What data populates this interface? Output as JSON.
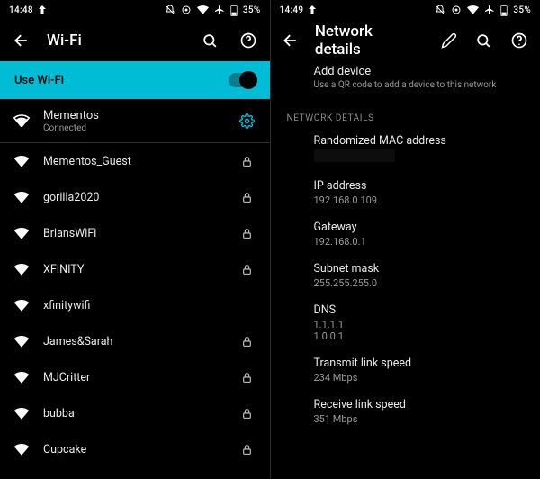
{
  "left": {
    "status": {
      "time": "14:48",
      "battery": "35%"
    },
    "title": "Wi-Fi",
    "toggleLabel": "Use Wi-Fi",
    "connected": {
      "name": "Mementos",
      "status": "Connected"
    },
    "networks": [
      {
        "name": "Mementos_Guest",
        "locked": true
      },
      {
        "name": "gorilla2020",
        "locked": true
      },
      {
        "name": "BriansWiFi",
        "locked": true
      },
      {
        "name": "XFINITY",
        "locked": true
      },
      {
        "name": "xfinitywifi",
        "locked": false
      },
      {
        "name": "James&Sarah",
        "locked": true
      },
      {
        "name": "MJCritter",
        "locked": true
      },
      {
        "name": "bubba",
        "locked": true
      },
      {
        "name": "Cupcake",
        "locked": true
      }
    ]
  },
  "right": {
    "status": {
      "time": "14:49",
      "battery": "35%"
    },
    "title": "Network details",
    "addDevice": {
      "title": "Add device",
      "subtitle": "Use a QR code to add a device to this network"
    },
    "sectionHeader": "Network Details",
    "details": [
      {
        "key": "Randomized MAC address",
        "value": "",
        "redacted": true
      },
      {
        "key": "IP address",
        "value": "192.168.0.109"
      },
      {
        "key": "Gateway",
        "value": "192.168.0.1"
      },
      {
        "key": "Subnet mask",
        "value": "255.255.255.0"
      },
      {
        "key": "DNS",
        "value": "1.1.1.1\n1.0.0.1"
      },
      {
        "key": "Transmit link speed",
        "value": "234 Mbps"
      },
      {
        "key": "Receive link speed",
        "value": "351 Mbps"
      }
    ]
  }
}
